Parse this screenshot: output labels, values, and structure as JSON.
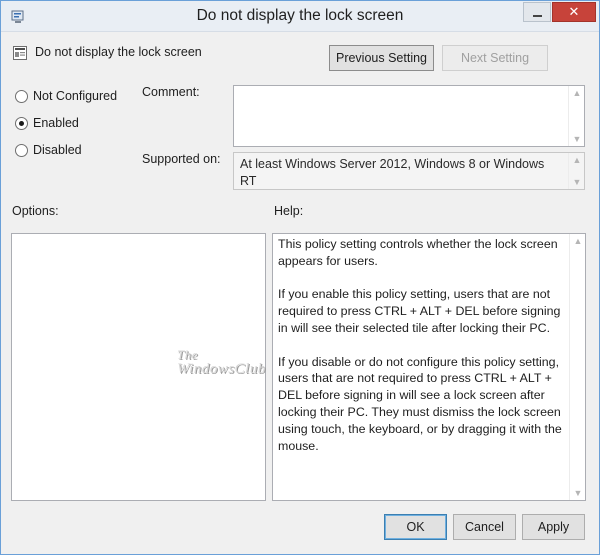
{
  "window": {
    "title": "Do not display the lock screen"
  },
  "header": {
    "policy_name": "Do not display the lock screen",
    "previous_label": "Previous Setting",
    "next_label": "Next Setting"
  },
  "state": {
    "options": [
      {
        "label": "Not Configured",
        "selected": false
      },
      {
        "label": "Enabled",
        "selected": true
      },
      {
        "label": "Disabled",
        "selected": false
      }
    ]
  },
  "comment": {
    "label": "Comment:",
    "value": ""
  },
  "supported": {
    "label": "Supported on:",
    "value": "At least Windows Server 2012, Windows 8 or Windows RT"
  },
  "options_panel": {
    "label": "Options:"
  },
  "help_panel": {
    "label": "Help:",
    "paragraphs": [
      "This policy setting controls whether the lock screen appears for users.",
      "If you enable this policy setting, users that are not required to press CTRL + ALT + DEL before signing in will see their selected tile after  locking their PC.",
      "If you disable or do not configure this policy setting, users that are not required to press CTRL + ALT + DEL before signing in will see a lock screen after locking their PC. They must dismiss the lock screen using touch, the keyboard, or by dragging it with the mouse."
    ]
  },
  "watermark": {
    "line1": "The",
    "line2": "WindowsClub"
  },
  "footer": {
    "ok_label": "OK",
    "cancel_label": "Cancel",
    "apply_label": "Apply"
  },
  "colors": {
    "close_button": "#c7433a",
    "ok_focus": "#3c7fb1"
  }
}
